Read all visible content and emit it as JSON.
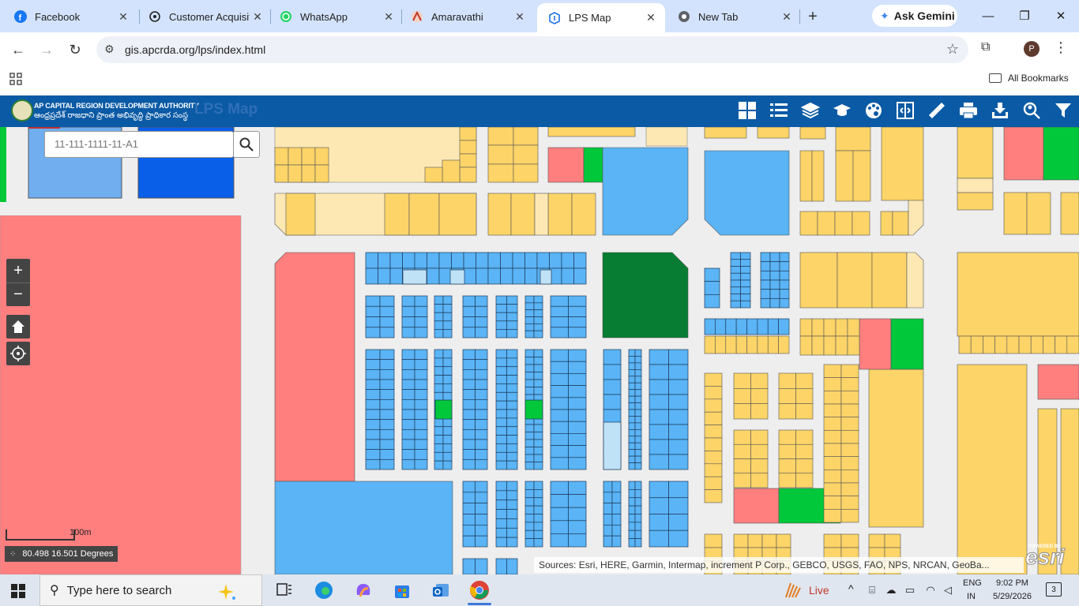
{
  "browser": {
    "tabs": [
      {
        "title": "Facebook",
        "icon": "facebook-icon",
        "color": "#1877f2"
      },
      {
        "title": "Customer Acquisiti",
        "icon": "chatgpt-icon",
        "color": "#222222"
      },
      {
        "title": "WhatsApp",
        "icon": "whatsapp-icon",
        "color": "#25d366"
      },
      {
        "title": "Amaravathi",
        "icon": "amaravathi-icon",
        "color": "#c0392b"
      },
      {
        "title": "LPS Map",
        "icon": "lps-map-icon",
        "color": "#1a73e8",
        "active": true
      },
      {
        "title": "New Tab",
        "icon": "chrome-icon",
        "color": "#5f6368"
      }
    ],
    "gemini_label": "Ask Gemini",
    "url": "gis.apcrda.org/lps/index.html",
    "all_bookmarks": "All Bookmarks",
    "profile_initial": "P"
  },
  "app": {
    "org_name_en": "AP CAPITAL REGION DEVELOPMENT AUTHORITY",
    "org_name_te": "ఆంధ్రప్రదేశ్ రాజధాని ప్రాంత అభివృద్ధి ప్రాధికార సంస్థ",
    "title": "LPS Map",
    "header_bg": "#0b5aa5",
    "tools": [
      "grid-icon",
      "list-icon",
      "layers-icon",
      "graduation-cap-icon",
      "palette-icon",
      "swipe-icon",
      "measure-icon",
      "print-icon",
      "download-icon",
      "search-people-icon",
      "filter-icon"
    ]
  },
  "map": {
    "search_placeholder": "11-111-1111-11-A1",
    "scale_label": "100m",
    "coords": "80.498 16.501 Degrees",
    "attribution": "Sources: Esri, HERE, Garmin, Intermap, increment P Corp., GEBCO, USGS, FAO, NPS, NRCAN, GeoBa...",
    "esri_powered": "POWERED BY",
    "esri_logo": "esri",
    "colors": {
      "commercial": "#ff7f7f",
      "residential_yellow": "#fcd468",
      "residential_light": "#fde8b3",
      "blue_plot": "#5ab4f5",
      "light_blue_plot": "#bfe2f7",
      "dark_green": "#067d33",
      "green": "#00c83a",
      "road": "#eeeeee"
    }
  },
  "taskbar": {
    "search_placeholder": "Type here to search",
    "live_label": "Live",
    "lang_line1": "ENG",
    "lang_line2": "IN",
    "time": "9:02 PM",
    "date": "5/29/2026",
    "notification_count": "3"
  }
}
